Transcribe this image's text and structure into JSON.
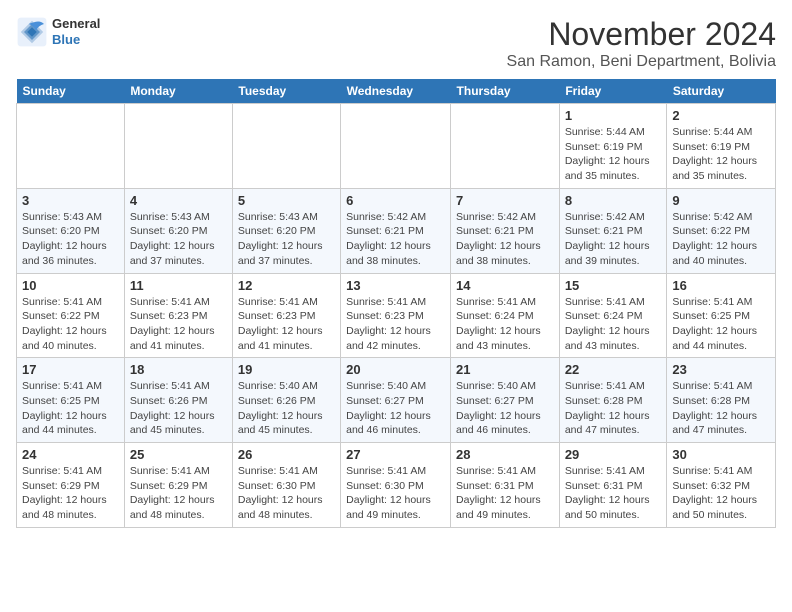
{
  "logo": {
    "line1": "General",
    "line2": "Blue"
  },
  "title": "November 2024",
  "subtitle": "San Ramon, Beni Department, Bolivia",
  "days_of_week": [
    "Sunday",
    "Monday",
    "Tuesday",
    "Wednesday",
    "Thursday",
    "Friday",
    "Saturday"
  ],
  "weeks": [
    [
      {
        "num": "",
        "detail": ""
      },
      {
        "num": "",
        "detail": ""
      },
      {
        "num": "",
        "detail": ""
      },
      {
        "num": "",
        "detail": ""
      },
      {
        "num": "",
        "detail": ""
      },
      {
        "num": "1",
        "detail": "Sunrise: 5:44 AM\nSunset: 6:19 PM\nDaylight: 12 hours and 35 minutes."
      },
      {
        "num": "2",
        "detail": "Sunrise: 5:44 AM\nSunset: 6:19 PM\nDaylight: 12 hours and 35 minutes."
      }
    ],
    [
      {
        "num": "3",
        "detail": "Sunrise: 5:43 AM\nSunset: 6:20 PM\nDaylight: 12 hours and 36 minutes."
      },
      {
        "num": "4",
        "detail": "Sunrise: 5:43 AM\nSunset: 6:20 PM\nDaylight: 12 hours and 37 minutes."
      },
      {
        "num": "5",
        "detail": "Sunrise: 5:43 AM\nSunset: 6:20 PM\nDaylight: 12 hours and 37 minutes."
      },
      {
        "num": "6",
        "detail": "Sunrise: 5:42 AM\nSunset: 6:21 PM\nDaylight: 12 hours and 38 minutes."
      },
      {
        "num": "7",
        "detail": "Sunrise: 5:42 AM\nSunset: 6:21 PM\nDaylight: 12 hours and 38 minutes."
      },
      {
        "num": "8",
        "detail": "Sunrise: 5:42 AM\nSunset: 6:21 PM\nDaylight: 12 hours and 39 minutes."
      },
      {
        "num": "9",
        "detail": "Sunrise: 5:42 AM\nSunset: 6:22 PM\nDaylight: 12 hours and 40 minutes."
      }
    ],
    [
      {
        "num": "10",
        "detail": "Sunrise: 5:41 AM\nSunset: 6:22 PM\nDaylight: 12 hours and 40 minutes."
      },
      {
        "num": "11",
        "detail": "Sunrise: 5:41 AM\nSunset: 6:23 PM\nDaylight: 12 hours and 41 minutes."
      },
      {
        "num": "12",
        "detail": "Sunrise: 5:41 AM\nSunset: 6:23 PM\nDaylight: 12 hours and 41 minutes."
      },
      {
        "num": "13",
        "detail": "Sunrise: 5:41 AM\nSunset: 6:23 PM\nDaylight: 12 hours and 42 minutes."
      },
      {
        "num": "14",
        "detail": "Sunrise: 5:41 AM\nSunset: 6:24 PM\nDaylight: 12 hours and 43 minutes."
      },
      {
        "num": "15",
        "detail": "Sunrise: 5:41 AM\nSunset: 6:24 PM\nDaylight: 12 hours and 43 minutes."
      },
      {
        "num": "16",
        "detail": "Sunrise: 5:41 AM\nSunset: 6:25 PM\nDaylight: 12 hours and 44 minutes."
      }
    ],
    [
      {
        "num": "17",
        "detail": "Sunrise: 5:41 AM\nSunset: 6:25 PM\nDaylight: 12 hours and 44 minutes."
      },
      {
        "num": "18",
        "detail": "Sunrise: 5:41 AM\nSunset: 6:26 PM\nDaylight: 12 hours and 45 minutes."
      },
      {
        "num": "19",
        "detail": "Sunrise: 5:40 AM\nSunset: 6:26 PM\nDaylight: 12 hours and 45 minutes."
      },
      {
        "num": "20",
        "detail": "Sunrise: 5:40 AM\nSunset: 6:27 PM\nDaylight: 12 hours and 46 minutes."
      },
      {
        "num": "21",
        "detail": "Sunrise: 5:40 AM\nSunset: 6:27 PM\nDaylight: 12 hours and 46 minutes."
      },
      {
        "num": "22",
        "detail": "Sunrise: 5:41 AM\nSunset: 6:28 PM\nDaylight: 12 hours and 47 minutes."
      },
      {
        "num": "23",
        "detail": "Sunrise: 5:41 AM\nSunset: 6:28 PM\nDaylight: 12 hours and 47 minutes."
      }
    ],
    [
      {
        "num": "24",
        "detail": "Sunrise: 5:41 AM\nSunset: 6:29 PM\nDaylight: 12 hours and 48 minutes."
      },
      {
        "num": "25",
        "detail": "Sunrise: 5:41 AM\nSunset: 6:29 PM\nDaylight: 12 hours and 48 minutes."
      },
      {
        "num": "26",
        "detail": "Sunrise: 5:41 AM\nSunset: 6:30 PM\nDaylight: 12 hours and 48 minutes."
      },
      {
        "num": "27",
        "detail": "Sunrise: 5:41 AM\nSunset: 6:30 PM\nDaylight: 12 hours and 49 minutes."
      },
      {
        "num": "28",
        "detail": "Sunrise: 5:41 AM\nSunset: 6:31 PM\nDaylight: 12 hours and 49 minutes."
      },
      {
        "num": "29",
        "detail": "Sunrise: 5:41 AM\nSunset: 6:31 PM\nDaylight: 12 hours and 50 minutes."
      },
      {
        "num": "30",
        "detail": "Sunrise: 5:41 AM\nSunset: 6:32 PM\nDaylight: 12 hours and 50 minutes."
      }
    ]
  ]
}
